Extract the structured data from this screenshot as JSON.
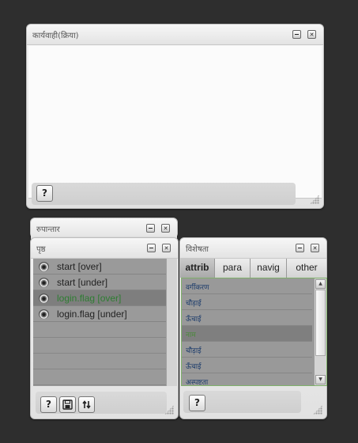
{
  "actions_panel": {
    "title": "कार्यवाही(क्रिया)",
    "help_label": "?"
  },
  "components_panel": {
    "title": "रुपान्तार"
  },
  "pages_panel": {
    "title": "पृष्ठ",
    "items": [
      {
        "label": "start [over]",
        "icon": "eye-icon"
      },
      {
        "label": "start [under]",
        "icon": "eye-icon"
      },
      {
        "label": "login.flag [over]",
        "icon": "eye-icon"
      },
      {
        "label": "login.flag [under]",
        "icon": "eye-icon"
      }
    ],
    "selected_index": 2,
    "help_label": "?",
    "save_icon": "save-icon",
    "swap_icon": "swap-icon"
  },
  "properties_panel": {
    "title": "विशेषता",
    "tabs": [
      "attrib",
      "para",
      "navig",
      "other"
    ],
    "active_tab": "attrib",
    "rows": [
      "वर्गीकरण",
      "चौड़ाई",
      "ऊँचाई",
      "नाम",
      "चौड़ाई",
      "ऊँचाई",
      "अस्पष्टता"
    ],
    "selected_index": 3,
    "help_label": "?"
  },
  "colors": {
    "background": "#2e2e2e",
    "selection": "#7e7e7e",
    "selected_text": "#2e7d32",
    "focus_border": "#7fb06a"
  }
}
